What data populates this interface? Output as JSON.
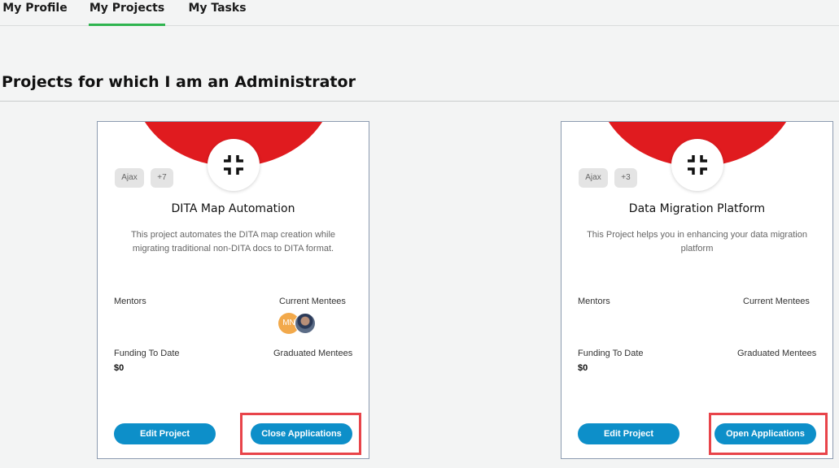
{
  "tabs": [
    {
      "label": "My Profile"
    },
    {
      "label": "My Projects"
    },
    {
      "label": "My Tasks"
    }
  ],
  "section_title": "Projects for which I am an Administrator",
  "cards": [
    {
      "tags": [
        "Ajax",
        "+7"
      ],
      "title": "DITA Map Automation",
      "description": "This project automates the DITA map creation while migrating traditional non-DITA docs to DITA format.",
      "mentors_label": "Mentors",
      "current_mentees_label": "Current Mentees",
      "mentee_initials": "MN",
      "funding_label": "Funding To Date",
      "funding_value": "$0",
      "graduated_label": "Graduated Mentees",
      "edit_label": "Edit Project",
      "applications_label": "Close Applications"
    },
    {
      "tags": [
        "Ajax",
        "+3"
      ],
      "title": "Data Migration Platform",
      "description": "This Project helps you in enhancing your data migration platform",
      "mentors_label": "Mentors",
      "current_mentees_label": "Current Mentees",
      "funding_label": "Funding To Date",
      "funding_value": "$0",
      "graduated_label": "Graduated Mentees",
      "edit_label": "Edit Project",
      "applications_label": "Open Applications"
    }
  ],
  "colors": {
    "accent_tab": "#2fb44f",
    "banner": "#e01b1f",
    "button": "#0d8fc9",
    "highlight": "#e8444a"
  },
  "icons": {
    "project_logo": "collapse-arrows-icon"
  }
}
